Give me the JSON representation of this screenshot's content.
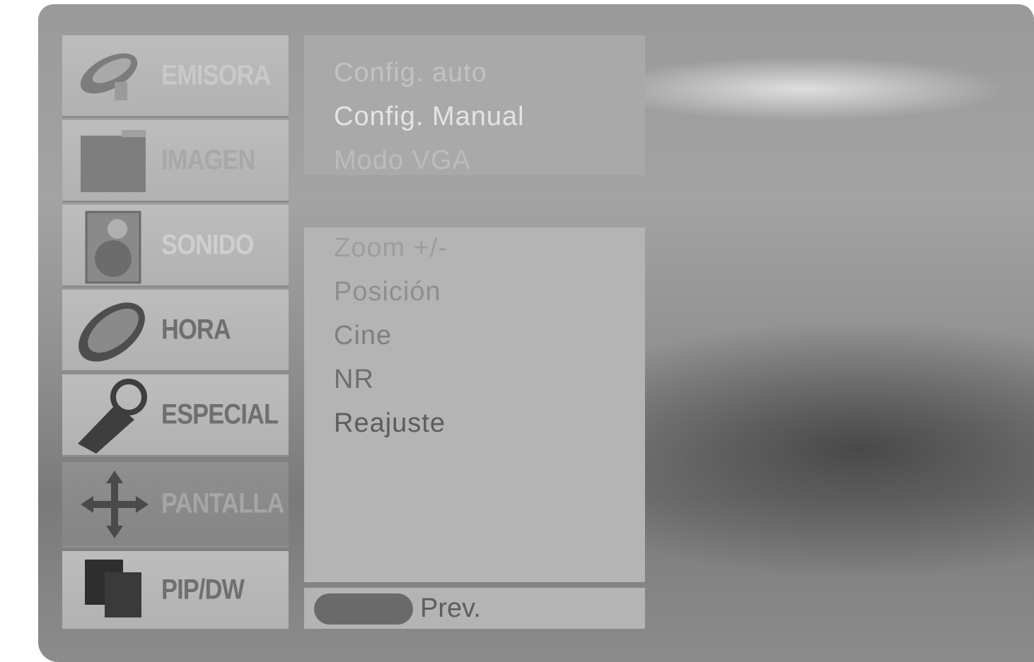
{
  "side_menu": [
    {
      "label": "EMISORA",
      "icon": "antenna-icon"
    },
    {
      "label": "IMAGEN",
      "icon": "picture-icon"
    },
    {
      "label": "SONIDO",
      "icon": "speaker-icon"
    },
    {
      "label": "HORA",
      "icon": "clock-icon"
    },
    {
      "label": "ESPECIAL",
      "icon": "tag-icon"
    },
    {
      "label": "PANTALLA",
      "icon": "move-arrows-icon",
      "selected": true
    },
    {
      "label": "PIP/DW",
      "icon": "pip-icon"
    }
  ],
  "top_panel": {
    "options": [
      "Config. auto",
      "Config. Manual",
      "Modo VGA"
    ]
  },
  "main_panel": {
    "options": [
      "Zoom +/-",
      "Posición",
      "Cine",
      "NR",
      "Reajuste"
    ]
  },
  "footer": {
    "prev_label": "Prev."
  }
}
